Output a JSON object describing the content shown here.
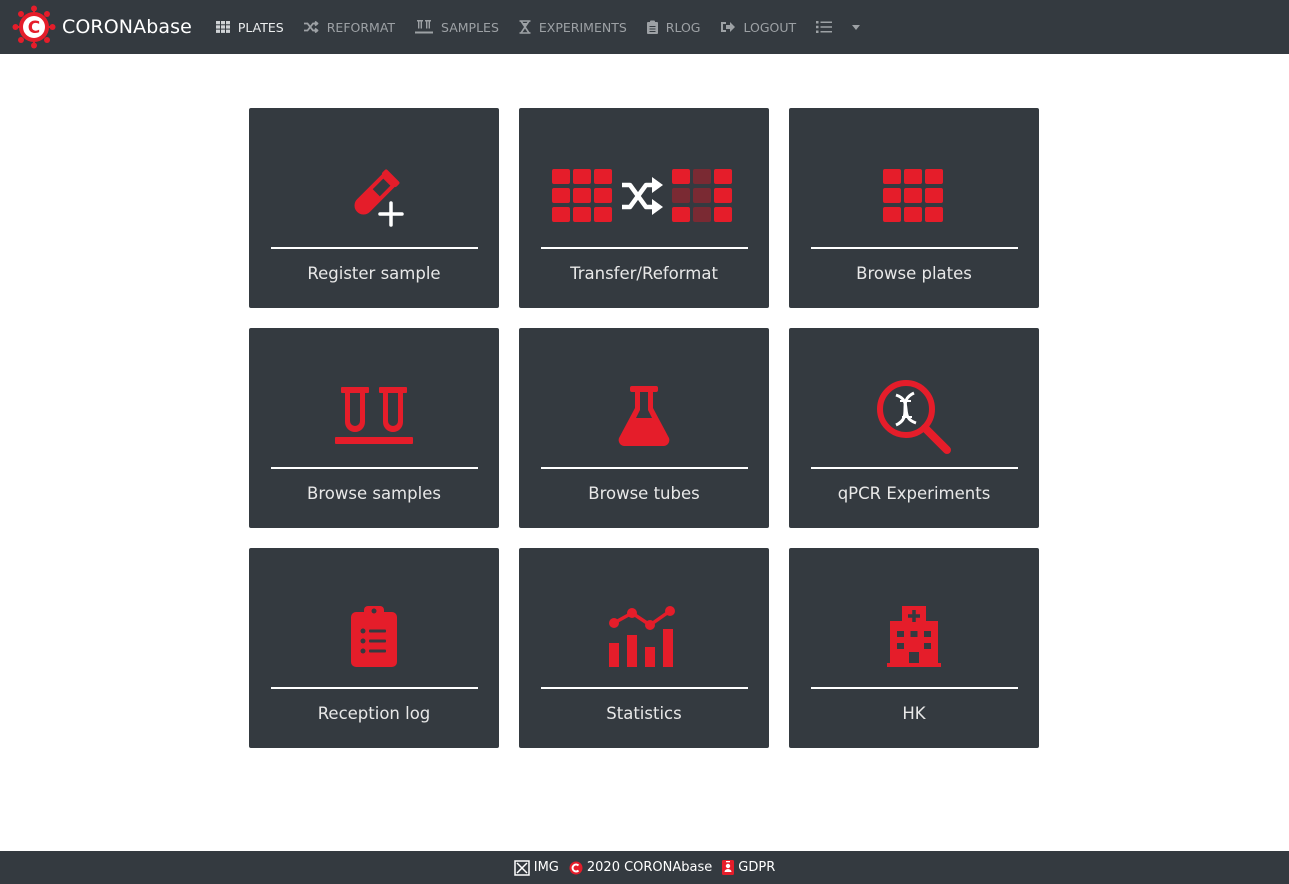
{
  "brand": {
    "name": "CORONAbase",
    "logo_letter": "C"
  },
  "nav": {
    "plates": "PLATES",
    "reformat": "REFORMAT",
    "samples": "SAMPLES",
    "experiments": "EXPERIMENTS",
    "rlog": "RLOG",
    "logout": "LOGOUT"
  },
  "cards": [
    {
      "label": "Register sample",
      "icon": "test-tube-plus-icon"
    },
    {
      "label": "Transfer/Reformat",
      "icon": "plate-transfer-icon"
    },
    {
      "label": "Browse plates",
      "icon": "plate-grid-icon"
    },
    {
      "label": "Browse samples",
      "icon": "tubes-rack-icon"
    },
    {
      "label": "Browse tubes",
      "icon": "flask-icon"
    },
    {
      "label": "qPCR Experiments",
      "icon": "dna-search-icon"
    },
    {
      "label": "Reception log",
      "icon": "clipboard-list-icon"
    },
    {
      "label": "Statistics",
      "icon": "bar-line-chart-icon"
    },
    {
      "label": "HK",
      "icon": "hospital-icon"
    }
  ],
  "footer": {
    "img": "IMG",
    "copyright": "2020 CORONAbase",
    "gdpr": "GDPR"
  },
  "colors": {
    "accent": "#e51d2a",
    "dark": "#343a40",
    "nav_text": "#9da1a5"
  }
}
